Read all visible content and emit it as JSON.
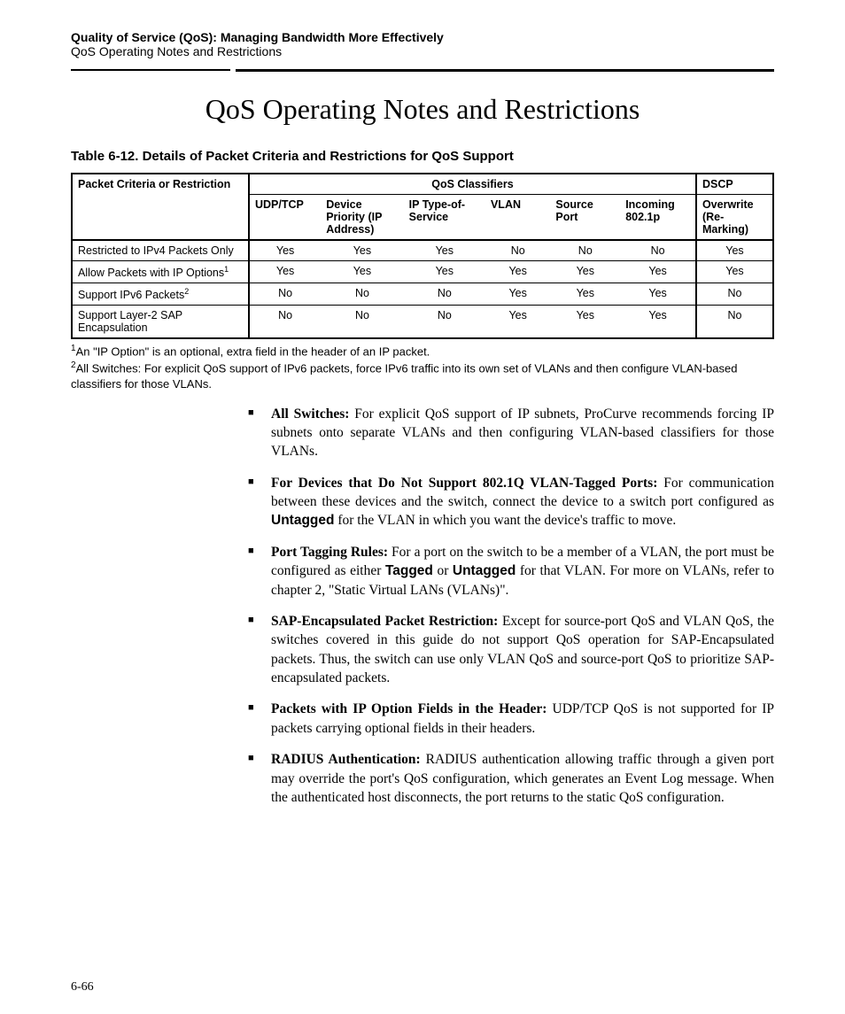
{
  "header": {
    "line1": "Quality of Service (QoS): Managing Bandwidth More Effectively",
    "line2": "QoS Operating Notes and Restrictions"
  },
  "title": "QoS Operating Notes and Restrictions",
  "table": {
    "caption": "Table 6-12. Details of Packet Criteria and Restrictions for QoS Support",
    "corner": "Packet Criteria or Restriction",
    "group_qos": "QoS Classifiers",
    "group_dscp": "DSCP",
    "cols": {
      "udp": "UDP/TCP",
      "dev": "Device Priority (IP Address)",
      "tos": "IP Type-of-Service",
      "vlan": "VLAN",
      "src": "Source Port",
      "inc": "Incoming 802.1p",
      "dscp": "Overwrite (Re-Marking)"
    },
    "rows": [
      {
        "label": "Restricted to IPv4 Packets Only",
        "v": [
          "Yes",
          "Yes",
          "Yes",
          "No",
          "No",
          "No",
          "Yes"
        ]
      },
      {
        "label": "Allow Packets with IP Options",
        "sup": "1",
        "v": [
          "Yes",
          "Yes",
          "Yes",
          "Yes",
          "Yes",
          "Yes",
          "Yes"
        ]
      },
      {
        "label": "Support IPv6 Packets",
        "sup": "2",
        "v": [
          "No",
          "No",
          "No",
          "Yes",
          "Yes",
          "Yes",
          "No"
        ]
      },
      {
        "label": "Support Layer-2 SAP Encapsulation",
        "v": [
          "No",
          "No",
          "No",
          "Yes",
          "Yes",
          "Yes",
          "No"
        ]
      }
    ],
    "footnotes": {
      "f1_sup": "1",
      "f1": "An \"IP Option\" is an optional, extra field in the header of an IP packet.",
      "f2_sup": "2",
      "f2": "All Switches: For explicit QoS support of IPv6 packets, force IPv6 traffic into its own set of VLANs and then configure VLAN-based classifiers for those VLANs."
    }
  },
  "bullets": [
    {
      "lead": "All Switches:",
      "rest": " For explicit QoS support of IP subnets, ProCurve recommends forcing IP subnets onto separate VLANs and then configuring VLAN-based classifiers for those VLANs."
    },
    {
      "lead": "For Devices that Do Not Support 802.1Q VLAN-Tagged Ports:",
      "rest_a": " For communication between these devices and the switch, connect the device to a switch port configured as ",
      "kw1": "Untagged",
      "rest_b": " for the VLAN in which you want the device's traffic to move."
    },
    {
      "lead": "Port Tagging Rules:",
      "rest_a": " For a port on the switch to be a member of a VLAN, the port must be configured as either ",
      "kw1": "Tagged",
      "mid": " or ",
      "kw2": "Untagged",
      "rest_b": " for that VLAN. For more on VLANs, refer to chapter 2, \"Static Virtual LANs (VLANs)\"."
    },
    {
      "lead": "SAP-Encapsulated Packet Restriction:",
      "rest": " Except for source-port QoS and VLAN QoS, the switches covered in this guide do not support QoS operation for SAP-Encapsulated packets. Thus, the switch can use only VLAN QoS and source-port QoS to prioritize SAP-encapsulated packets."
    },
    {
      "lead": "Packets with IP Option Fields in the Header:",
      "rest": " UDP/TCP QoS is not supported for IP packets carrying optional fields in their headers."
    },
    {
      "lead": "RADIUS Authentication:",
      "rest": " RADIUS authentication allowing traffic through a given port may override the port's QoS configuration, which generates an Event Log message. When the authenticated host disconnects, the port returns to the static QoS configuration."
    }
  ],
  "page_number": "6-66"
}
